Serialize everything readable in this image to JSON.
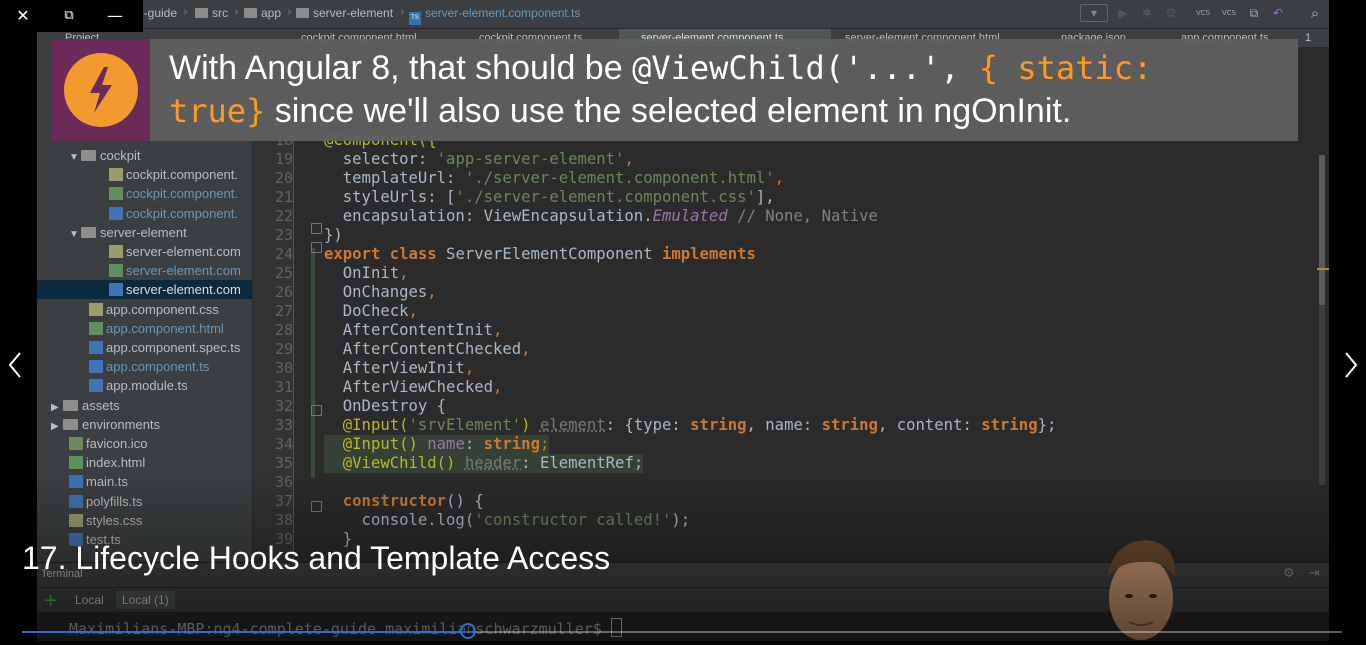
{
  "window": {
    "close": "✕",
    "restore": "⧉",
    "minimize": "—"
  },
  "breadcrumb": [
    "e-guide",
    "src",
    "app",
    "server-element",
    "server-element.component.ts"
  ],
  "tabs": [
    {
      "label": "Project",
      "active": false
    },
    {
      "label": "cockpit.component.html",
      "active": false
    },
    {
      "label": "cockpit.component.ts",
      "active": false
    },
    {
      "label": "server-element.component.ts",
      "active": true
    },
    {
      "label": "server-element.component.html",
      "active": false
    },
    {
      "label": "package.json",
      "active": false
    },
    {
      "label": "app.component.ts",
      "active": false
    },
    {
      "label": "1",
      "active": false
    }
  ],
  "toolbar_vcs": [
    "VCS",
    "VCS"
  ],
  "sidebar": {
    "items": [
      {
        "label": "cockpit",
        "type": "folder",
        "indent": 2,
        "arrow": "▼"
      },
      {
        "label": "cockpit.component.",
        "type": "css",
        "indent": 4
      },
      {
        "label": "cockpit.component.",
        "type": "html",
        "indent": 4,
        "blue": true
      },
      {
        "label": "cockpit.component.",
        "type": "ts",
        "indent": 4,
        "blue": true
      },
      {
        "label": "server-element",
        "type": "folder",
        "indent": 2,
        "arrow": "▼"
      },
      {
        "label": "server-element.com",
        "type": "css",
        "indent": 4
      },
      {
        "label": "server-element.com",
        "type": "html",
        "indent": 4,
        "blue": true
      },
      {
        "label": "server-element.com",
        "type": "ts",
        "indent": 4,
        "selected": true
      },
      {
        "label": "app.component.css",
        "type": "css",
        "indent": 3
      },
      {
        "label": "app.component.html",
        "type": "html",
        "indent": 3,
        "blue": true
      },
      {
        "label": "app.component.spec.ts",
        "type": "ts",
        "indent": 3
      },
      {
        "label": "app.component.ts",
        "type": "ts",
        "indent": 3,
        "blue": true
      },
      {
        "label": "app.module.ts",
        "type": "ts",
        "indent": 3
      },
      {
        "label": "assets",
        "type": "folder",
        "indent": 1,
        "arrow": "▶"
      },
      {
        "label": "environments",
        "type": "folder",
        "indent": 1,
        "arrow": "▶"
      },
      {
        "label": "favicon.ico",
        "type": "ico",
        "indent": 2
      },
      {
        "label": "index.html",
        "type": "html",
        "indent": 2
      },
      {
        "label": "main.ts",
        "type": "ts",
        "indent": 2
      },
      {
        "label": "polyfills.ts",
        "type": "ts",
        "indent": 2
      },
      {
        "label": "styles.css",
        "type": "css",
        "indent": 2
      },
      {
        "label": "test.ts",
        "type": "ts",
        "indent": 2
      }
    ]
  },
  "editor": {
    "line_numbers": [
      "18",
      "19",
      "20",
      "21",
      "22",
      "23",
      "24",
      "25",
      "26",
      "27",
      "28",
      "29",
      "30",
      "31",
      "32",
      "33",
      "34",
      "35",
      "36",
      "37",
      "38",
      "39"
    ],
    "lines": {
      "l18": "@Component({",
      "l19a": "  selector: ",
      "l19b": "'app-server-element'",
      "l19c": ",",
      "l20a": "  templateUrl: ",
      "l20b": "'./server-element.component.html'",
      "l20c": ",",
      "l21a": "  styleUrls: [",
      "l21b": "'./server-element.component.css'",
      "l21c": "],",
      "l22a": "  encapsulation: ViewEncapsulation.",
      "l22b": "Emulated",
      "l22c": " // None, Native",
      "l23": "})",
      "l24a": "export class",
      "l24b": " ServerElementComponent ",
      "l24c": "implements",
      "l25": "  OnInit",
      "l26": "  OnChanges",
      "l27": "  DoCheck",
      "l28": "  AfterContentInit",
      "l29": "  AfterContentChecked",
      "l30": "  AfterViewInit",
      "l31": "  AfterViewChecked",
      "l32": "  OnDestroy {",
      "l33a": "  @Input(",
      "l33b": "'srvElement'",
      "l33c": ") ",
      "l33d": "element",
      "l33e": ": {type: ",
      "l33f": "string",
      "l33g": ", name: ",
      "l33h": "string",
      "l33i": ", content: ",
      "l33j": "string",
      "l33k": "};",
      "l34a": "  @Input() ",
      "l34b": "name",
      "l34c": ": ",
      "l34d": "string",
      "l34e": ";",
      "l35a": "  @ViewChild() ",
      "l35b": "header",
      "l35c": ": ElementRef;",
      "l37a": "  ",
      "l37b": "constructor",
      "l37c": "() {",
      "l38a": "    console.log(",
      "l38b": "'constructor called!'",
      "l38c": ");",
      "l39": "  }",
      "comma": ","
    }
  },
  "terminal": {
    "title": "Terminal",
    "tabs": [
      "Local",
      "Local (1)"
    ],
    "prompt": "Maximilians-MBP:ng4-complete-guide maximilianschwarzmuller$ "
  },
  "banner": {
    "text1": "With Angular 8, that should be ",
    "code1": "@ViewChild('...', ",
    "code2": "{ static:",
    "code3": "true}",
    "text2": " since we'll also use the selected element in ngOnInit."
  },
  "lecture_title": "17. Lifecycle Hooks and Template Access",
  "progress": {
    "fraction": 0.338
  },
  "colors": {
    "accent": "#2b6fd6",
    "banner_code": "#ff9a1e",
    "logo_bg": "#6b2b5a",
    "logo_circle": "#f29a2e"
  }
}
